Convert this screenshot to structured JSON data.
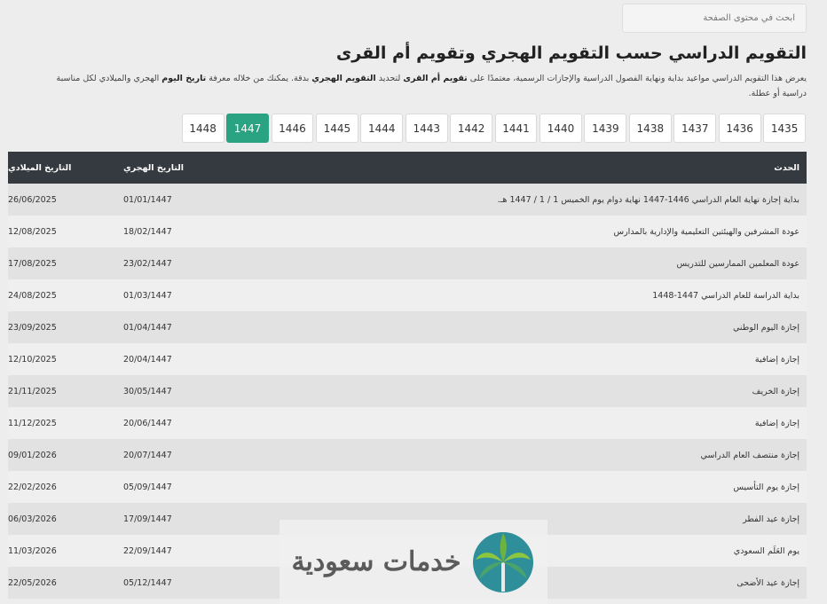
{
  "search": {
    "placeholder": "ابحث في محتوى الصفحة"
  },
  "page": {
    "title": "التقويم الدراسي حسب التقويم الهجري وتقويم أم القرى",
    "intro_1": "يعرض هذا التقويم الدراسي مواعيد بداية ونهاية الفصول الدراسية والإجازات الرسمية، معتمدًا على ",
    "intro_bold_1": "تقويم أم القرى",
    "intro_2": " لتحديد ",
    "intro_bold_2": "التقويم الهجري",
    "intro_3": " بدقة. يمكنك من خلاله معرفة ",
    "intro_bold_3": "تاريخ اليوم",
    "intro_4": " الهجري والميلادي لكل مناسبة دراسية أو عطلة."
  },
  "years": [
    "1435",
    "1436",
    "1437",
    "1438",
    "1439",
    "1440",
    "1441",
    "1442",
    "1443",
    "1444",
    "1445",
    "1446",
    "1447",
    "1448"
  ],
  "active_year": "1447",
  "accent_color": "#2aa383",
  "table": {
    "headers": {
      "event": "الحدث",
      "hijri": "التاريخ الهجري",
      "gregorian": "التاريخ الميلادي"
    },
    "rows": [
      {
        "event": "بداية إجازة نهاية العام الدراسي 1446-1447 نهاية دوام يوم الخميس 1 / 1 / 1447 هـ.",
        "hijri": "01/01/1447",
        "gregorian": "26/06/2025"
      },
      {
        "event": "عودة المشرفين والهيئتين التعليمية والإدارية بالمدارس",
        "hijri": "18/02/1447",
        "gregorian": "12/08/2025"
      },
      {
        "event": "عودة المعلمين الممارسين للتدريس",
        "hijri": "23/02/1447",
        "gregorian": "17/08/2025"
      },
      {
        "event": "بداية الدراسة للعام الدراسي 1447-1448",
        "hijri": "01/03/1447",
        "gregorian": "24/08/2025"
      },
      {
        "event": "إجازة اليوم الوطني",
        "hijri": "01/04/1447",
        "gregorian": "23/09/2025"
      },
      {
        "event": "إجازة إضافية",
        "hijri": "20/04/1447",
        "gregorian": "12/10/2025"
      },
      {
        "event": "إجازة الخريف",
        "hijri": "30/05/1447",
        "gregorian": "21/11/2025"
      },
      {
        "event": "إجازة إضافية",
        "hijri": "20/06/1447",
        "gregorian": "11/12/2025"
      },
      {
        "event": "إجازة منتصف العام الدراسي",
        "hijri": "20/07/1447",
        "gregorian": "09/01/2026"
      },
      {
        "event": "إجازة يوم التأسيس",
        "hijri": "05/09/1447",
        "gregorian": "22/02/2026"
      },
      {
        "event": "إجازة عيد الفطر",
        "hijri": "17/09/1447",
        "gregorian": "06/03/2026"
      },
      {
        "event": "يوم العَلَم السعودي",
        "hijri": "22/09/1447",
        "gregorian": "11/03/2026"
      },
      {
        "event": "إجازة عيد الأضحى",
        "hijri": "05/12/1447",
        "gregorian": "22/05/2026"
      }
    ]
  },
  "watermark": {
    "text": "خدمات سعودية",
    "icon": "palm-logo-icon"
  }
}
